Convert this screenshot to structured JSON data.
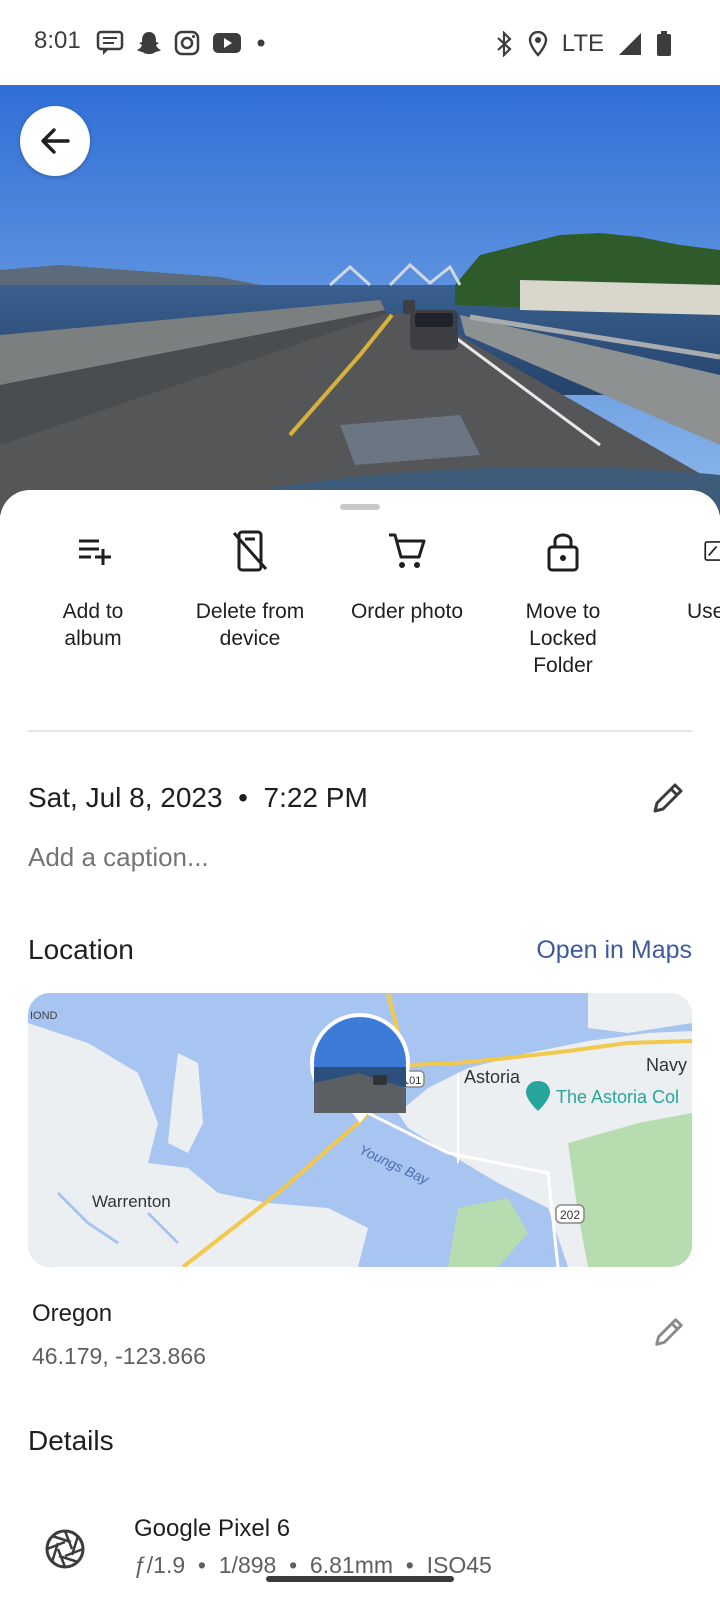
{
  "status_bar": {
    "time": "8:01",
    "network": "LTE",
    "icons": [
      "message-icon",
      "snapchat-icon",
      "instagram-icon",
      "youtube-icon",
      "dot-icon",
      "bluetooth-icon",
      "location-icon",
      "signal-icon",
      "battery-icon"
    ]
  },
  "actions": [
    {
      "label": "Add to\nalbum",
      "icon": "playlist-add-icon"
    },
    {
      "label": "Delete from\ndevice",
      "icon": "delete-device-icon"
    },
    {
      "label": "Order photo",
      "icon": "cart-icon"
    },
    {
      "label": "Move to\nLocked\nFolder",
      "icon": "lock-icon"
    },
    {
      "label": "Use",
      "icon": "use-as-icon"
    }
  ],
  "info": {
    "date": "Sat, Jul 8, 2023  •  7:22 PM",
    "caption_placeholder": "Add a caption..."
  },
  "location": {
    "title": "Location",
    "open_maps": "Open in Maps",
    "map_labels": {
      "edge": "IOND",
      "astoria": "Astoria",
      "navy": "Navy",
      "poi": "The Astoria Col",
      "bay": "Youngs Bay",
      "warrenton": "Warrenton",
      "route101": "101",
      "route202": "202"
    },
    "place": "Oregon",
    "coords": "46.179, -123.866"
  },
  "details": {
    "title": "Details",
    "camera": "Google Pixel 6",
    "specs": "ƒ/1.9  •  1/898  •  6.81mm  •  ISO45"
  },
  "colors": {
    "accent_link": "#3f5a9c",
    "map_water": "#a8c4f0",
    "map_land": "#eceff1",
    "map_park": "#b7dcb0"
  }
}
